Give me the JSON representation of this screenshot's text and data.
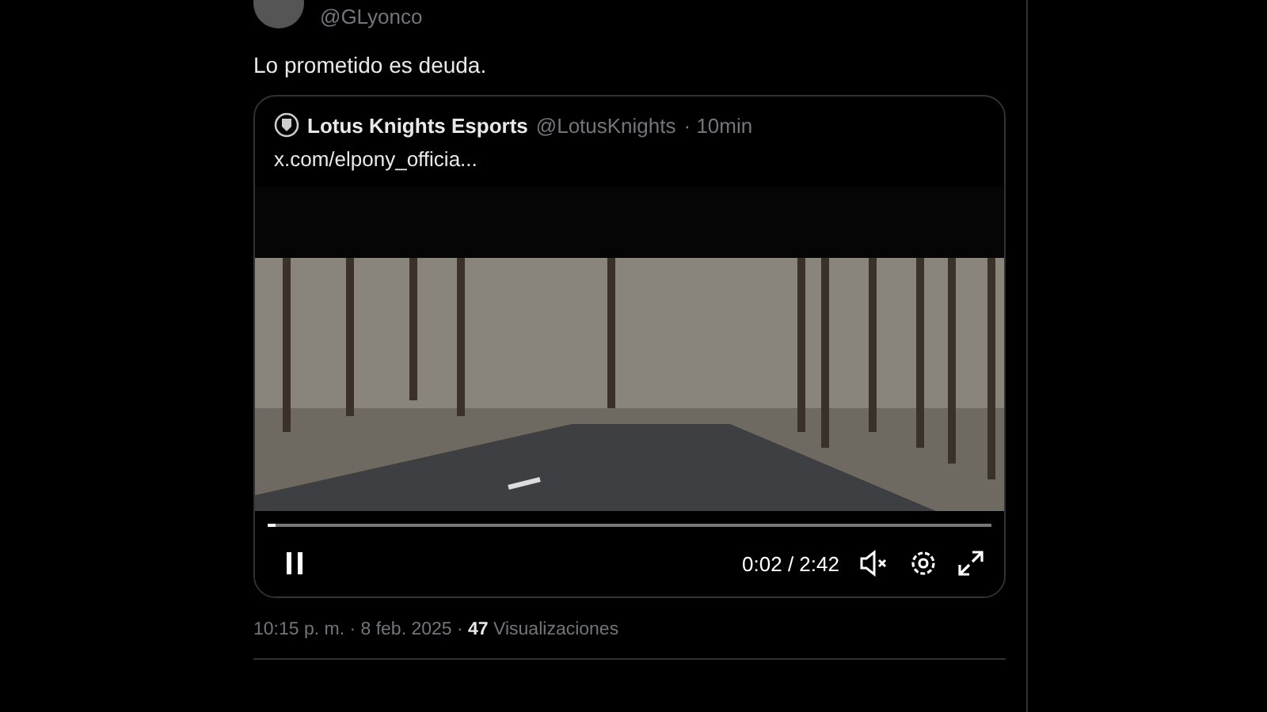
{
  "author": {
    "handle": "@GLyonco"
  },
  "post": {
    "text": "Lo prometido es deuda.",
    "meta": "10:15 p. m. · 8 feb. 2025 · **47** Visualizaciones"
  },
  "quote": {
    "name": "Lotus Knights Esports",
    "handle": "@LotusKnights",
    "time": "· 10min",
    "link": "x.com/elpony_officia..."
  },
  "video": {
    "playing": true,
    "muted": true,
    "level": 0.012,
    "time": "0:02 / 2:42"
  }
}
